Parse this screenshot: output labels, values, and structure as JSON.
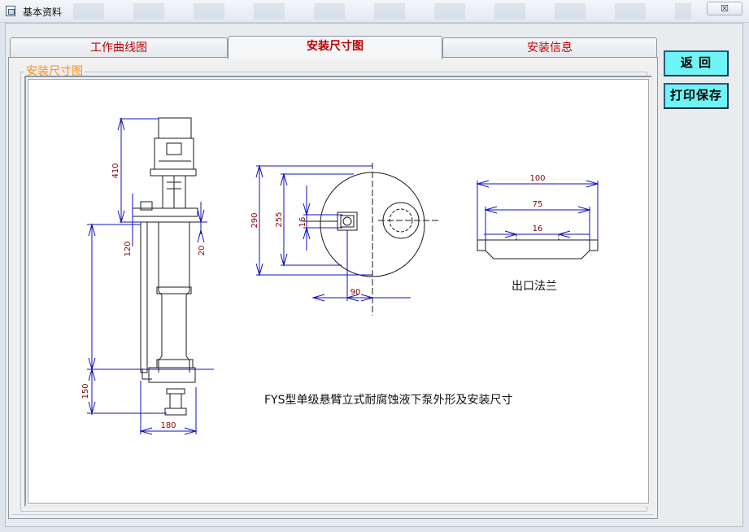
{
  "window": {
    "title": "基本资料",
    "close_label": "☒"
  },
  "tabs": [
    {
      "label": "工作曲线图",
      "active": false
    },
    {
      "label": "安装尺寸图",
      "active": true
    },
    {
      "label": "安装信息",
      "active": false
    }
  ],
  "group": {
    "legend": "安装尺寸图"
  },
  "drawing": {
    "caption": "FYS型单级悬臂立式耐腐蚀液下泵外形及安装尺寸",
    "flange_label": "出口法兰",
    "dims": {
      "side_410": "410",
      "side_120": "120",
      "side_20": "20",
      "side_150": "150",
      "side_180": "180",
      "top_290": "290",
      "top_255": "255",
      "top_16": "16",
      "top_90": "90",
      "flange_100": "100",
      "flange_75": "75",
      "flange_16": "16"
    }
  },
  "buttons": {
    "back": "返 回",
    "print_save": "打印保存"
  },
  "colors": {
    "tab_text": "#c00000",
    "legend": "#ff8c1a",
    "dimension_line": "#1010c0",
    "dimension_text": "#8b0000",
    "button_bg": "#6ff4f6"
  }
}
